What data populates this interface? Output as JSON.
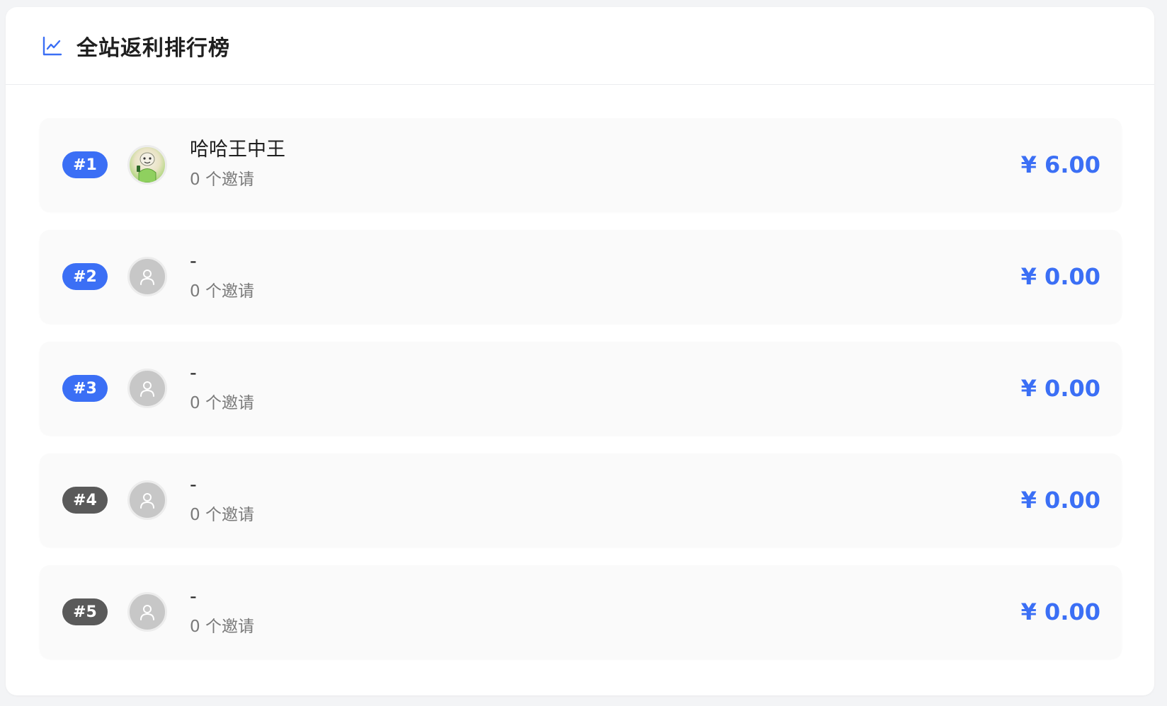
{
  "header": {
    "title": "全站返利排行榜",
    "icon": "line-chart-icon"
  },
  "colors": {
    "accent": "#3b6ff5",
    "badge_top": "#3b6ff5",
    "badge_other": "#5a5a5a"
  },
  "leaderboard": [
    {
      "rank": "#1",
      "name": "哈哈王中王",
      "invites": "0 个邀请",
      "amount": "¥ 6.00",
      "avatar": "photo-avatar",
      "badge_style": "top"
    },
    {
      "rank": "#2",
      "name": "-",
      "invites": "0 个邀请",
      "amount": "¥ 0.00",
      "avatar": "user-icon",
      "badge_style": "top"
    },
    {
      "rank": "#3",
      "name": "-",
      "invites": "0 个邀请",
      "amount": "¥ 0.00",
      "avatar": "user-icon",
      "badge_style": "top"
    },
    {
      "rank": "#4",
      "name": "-",
      "invites": "0 个邀请",
      "amount": "¥ 0.00",
      "avatar": "user-icon",
      "badge_style": "other"
    },
    {
      "rank": "#5",
      "name": "-",
      "invites": "0 个邀请",
      "amount": "¥ 0.00",
      "avatar": "user-icon",
      "badge_style": "other"
    }
  ]
}
